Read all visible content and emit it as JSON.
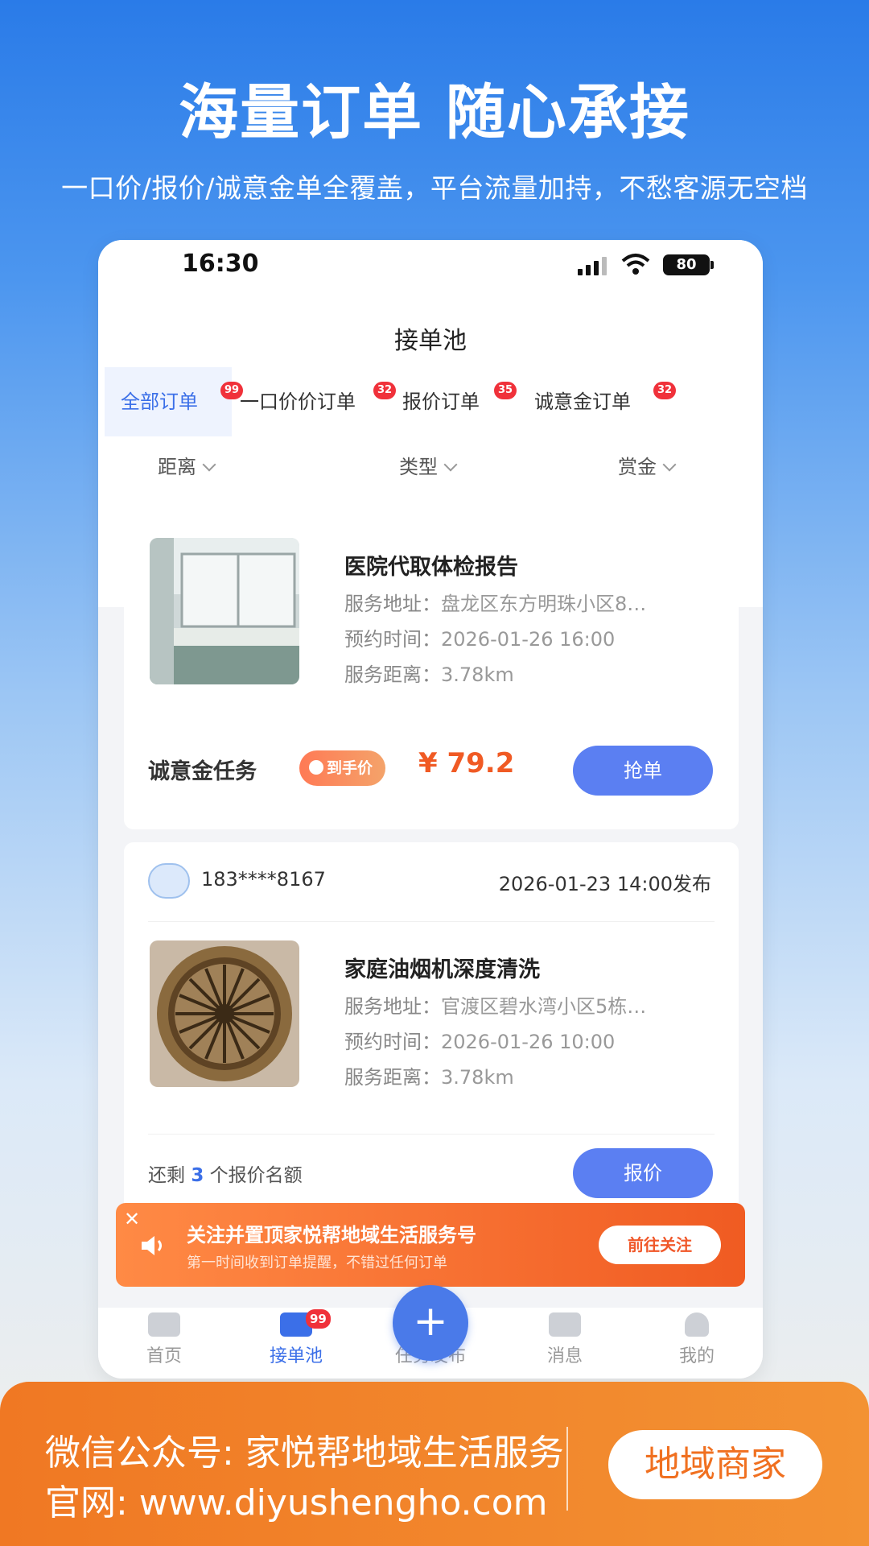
{
  "promo": {
    "headline": "海量订单 随心承接",
    "subline": "一口价/报价/诚意金单全覆盖，平台流量加持，不愁客源无空档"
  },
  "status_bar": {
    "time": "16:30",
    "battery": "80"
  },
  "page": {
    "title": "接单池"
  },
  "tabs": [
    {
      "label": "全部订单",
      "badge": "99"
    },
    {
      "label": "一口价价订单",
      "badge": "32"
    },
    {
      "label": "报价订单",
      "badge": "35"
    },
    {
      "label": "诚意金订单",
      "badge": "32"
    }
  ],
  "filters": [
    {
      "label": "距离"
    },
    {
      "label": "类型"
    },
    {
      "label": "赏金"
    }
  ],
  "orders": [
    {
      "title": "医院代取体检报告",
      "address_label": "服务地址：",
      "address": "盘龙区东方明珠小区8…",
      "time_label": "预约时间：",
      "time": "2026-01-26 16:00",
      "distance_label": "服务距离：",
      "distance": "3.78km",
      "type_label": "诚意金任务",
      "price_tag": "到手价",
      "price": "¥ 79.2",
      "action": "抢单"
    },
    {
      "user": "183****8167",
      "published": "2026-01-23 14:00发布",
      "title": "家庭油烟机深度清洗",
      "address_label": "服务地址：",
      "address": "官渡区碧水湾小区5栋…",
      "time_label": "预约时间：",
      "time": "2026-01-26 10:00",
      "distance_label": "服务距离：",
      "distance": "3.78km",
      "quota_prefix": "还剩",
      "quota_count": "3",
      "quota_suffix": "个报价名额",
      "action": "报价"
    }
  ],
  "notice": {
    "title": "关注并置顶家悦帮地域生活服务号",
    "subtitle": "第一时间收到订单提醒，不错过任何订单",
    "button": "前往关注"
  },
  "tabbar": {
    "items": [
      {
        "label": "首页"
      },
      {
        "label": "接单池",
        "badge": "99"
      },
      {
        "label": "任务发布"
      },
      {
        "label": "消息"
      },
      {
        "label": "我的"
      }
    ],
    "fab_symbol": "+"
  },
  "banner": {
    "line1": "微信公众号: 家悦帮地域生活服务",
    "line2": "官网: www.diyushengho.com",
    "button": "地域商家"
  },
  "colors": {
    "accent": "#3b6fe8",
    "price": "#f05a24",
    "banner": "#f07823"
  }
}
